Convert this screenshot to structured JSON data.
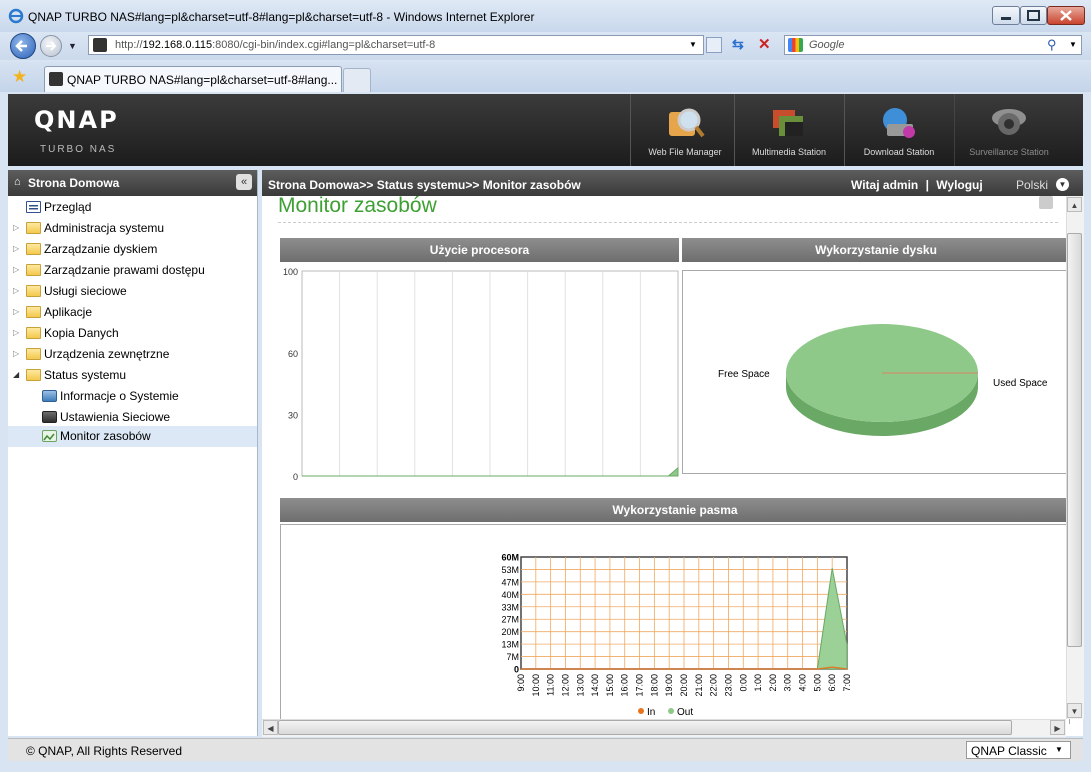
{
  "window": {
    "title": "QNAP TURBO NAS#lang=pl&charset=utf-8#lang=pl&charset=utf-8 - Windows Internet Explorer"
  },
  "browser": {
    "url_prefix": "http://",
    "url_host": "192.168.0.115",
    "url_rest": ":8080/cgi-bin/index.cgi#lang=pl&charset=utf-8",
    "search_placeholder": "Google",
    "tab_title": "QNAP TURBO NAS#lang=pl&charset=utf-8#lang..."
  },
  "header": {
    "logo": "QNAP",
    "logo_sub": "Turbo NAS",
    "apps": [
      {
        "label": "Web File Manager",
        "icon": "web-file-manager-icon"
      },
      {
        "label": "Multimedia Station",
        "icon": "multimedia-station-icon"
      },
      {
        "label": "Download Station",
        "icon": "download-station-icon"
      },
      {
        "label": "Surveillance Station",
        "icon": "surveillance-station-icon"
      }
    ]
  },
  "sidebar": {
    "title": "Strona Domowa",
    "items": [
      {
        "label": "Przegląd"
      },
      {
        "label": "Administracja systemu"
      },
      {
        "label": "Zarządzanie dyskiem"
      },
      {
        "label": "Zarządzanie prawami dostępu"
      },
      {
        "label": "Usługi sieciowe"
      },
      {
        "label": "Aplikacje"
      },
      {
        "label": "Kopia Danych"
      },
      {
        "label": "Urządzenia zewnętrzne"
      },
      {
        "label": "Status systemu"
      }
    ],
    "subitems": [
      {
        "label": "Informacje o Systemie"
      },
      {
        "label": "Ustawienia Sieciowe"
      },
      {
        "label": "Monitor zasobów"
      }
    ]
  },
  "main": {
    "breadcrumb": "Strona Domowa>> Status systemu>> Monitor zasobów",
    "welcome": "Witaj admin",
    "logout": "Wyloguj",
    "language": "Polski",
    "page_title": "Monitor zasobów",
    "panels": {
      "cpu": "Użycie procesora",
      "disk": "Wykorzystanie dysku",
      "bandwidth": "Wykorzystanie pasma"
    }
  },
  "footer": {
    "copyright": "© QNAP, All Rights Reserved",
    "theme": "QNAP Classic"
  },
  "colors": {
    "accent_green": "#3ea033",
    "chart_green": "#8fc98a",
    "chart_orange": "#e8741e",
    "header_dark": "#2a2a2a"
  },
  "chart_data": [
    {
      "type": "area",
      "title": "Użycie procesora",
      "ylim": [
        0,
        100
      ],
      "yticks": [
        "100",
        "60",
        "30",
        "0"
      ],
      "series": [
        {
          "values": [
            0,
            0,
            0,
            0,
            0,
            0,
            0,
            0,
            0,
            0,
            0,
            0,
            0,
            0,
            0,
            0,
            0,
            0,
            0,
            0,
            0,
            0,
            0,
            0,
            0,
            0,
            0,
            0,
            0,
            0,
            0,
            0,
            0,
            0,
            0,
            0,
            0,
            0,
            0,
            4
          ]
        }
      ],
      "grid": true
    },
    {
      "type": "pie",
      "title": "Wykorzystanie dysku",
      "labels": [
        "Free Space",
        "Used Space"
      ],
      "values": [
        99.9,
        0.1
      ]
    },
    {
      "type": "area",
      "title": "Wykorzystanie pasma",
      "categories": [
        "9:00",
        "10:00",
        "11:00",
        "12:00",
        "13:00",
        "14:00",
        "15:00",
        "16:00",
        "17:00",
        "18:00",
        "19:00",
        "20:00",
        "21:00",
        "22:00",
        "23:00",
        "0:00",
        "1:00",
        "2:00",
        "3:00",
        "4:00",
        "5:00",
        "6:00",
        "7:00"
      ],
      "ytick_labels": [
        "60M",
        "53M",
        "47M",
        "40M",
        "33M",
        "27M",
        "20M",
        "13M",
        "7M",
        "0"
      ],
      "ylim": [
        0,
        60
      ],
      "series": [
        {
          "name": "In",
          "color": "#e8741e",
          "values": [
            0,
            0,
            0,
            0,
            0,
            0,
            0,
            0,
            0,
            0,
            0,
            0,
            0,
            0,
            0,
            0,
            0,
            0,
            0,
            0,
            0,
            1,
            0
          ]
        },
        {
          "name": "Out",
          "color": "#8fc98a",
          "values": [
            0,
            0,
            0,
            0,
            0,
            0,
            0,
            0,
            0,
            0,
            0,
            0,
            0,
            0,
            0,
            0,
            0,
            0,
            0,
            0,
            0,
            54,
            13
          ]
        }
      ],
      "legend": "bottom",
      "grid": true
    }
  ]
}
